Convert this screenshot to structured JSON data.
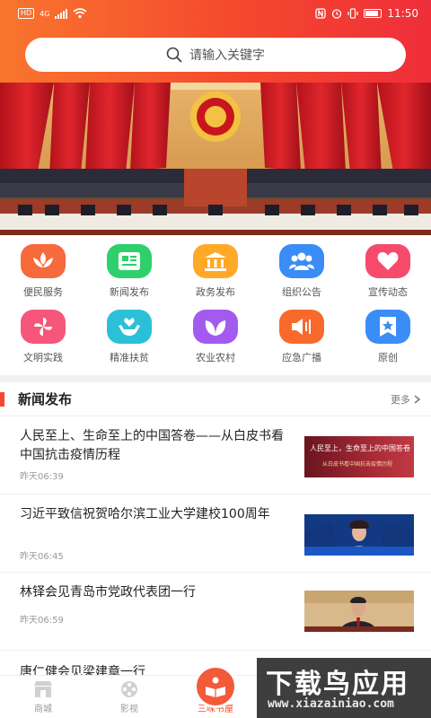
{
  "status_bar": {
    "network": "4G",
    "time": "11:50",
    "hd": "HD"
  },
  "search": {
    "placeholder": "请输入关键字"
  },
  "grid": {
    "items": [
      {
        "label": "便民服务",
        "icon": "flower-icon",
        "color": "#f66a3c"
      },
      {
        "label": "新闻发布",
        "icon": "newspaper-icon",
        "color": "#2fcf6b"
      },
      {
        "label": "政务发布",
        "icon": "government-building-icon",
        "color": "#ffa928"
      },
      {
        "label": "组织公告",
        "icon": "group-icon",
        "color": "#3a8cf6"
      },
      {
        "label": "宣传动态",
        "icon": "heart-icon",
        "color": "#f64a6c"
      },
      {
        "label": "文明实践",
        "icon": "pinwheel-icon",
        "color": "#f6567a"
      },
      {
        "label": "精准扶贫",
        "icon": "hands-heart-icon",
        "color": "#2cc0d8"
      },
      {
        "label": "农业农村",
        "icon": "leaf-icon",
        "color": "#a35bef"
      },
      {
        "label": "应急广播",
        "icon": "speaker-icon",
        "color": "#f76a2c"
      },
      {
        "label": "原创",
        "icon": "star-bookmark-icon",
        "color": "#3a8cf6"
      }
    ]
  },
  "section": {
    "title": "新闻发布",
    "more": "更多"
  },
  "news": [
    {
      "title": "人民至上、生命至上的中国答卷——从白皮书看中国抗击疫情历程",
      "time": "昨天06:39",
      "thumb_line1": "人民至上，生命至上的中国答卷",
      "thumb_line2": "从白皮书看中国抗击疫情历程"
    },
    {
      "title": "习近平致信祝贺哈尔滨工业大学建校100周年",
      "time": "昨天06:45"
    },
    {
      "title": "林铎会见青岛市党政代表团一行",
      "time": "昨天06:59"
    }
  ],
  "news_partial": "唐仁健会见梁建章一行",
  "tabs": [
    {
      "label": "商城",
      "icon": "shop-icon"
    },
    {
      "label": "影视",
      "icon": "film-reel-icon"
    },
    {
      "label": "三味书屋",
      "icon": "reading-book-icon",
      "active": true
    }
  ],
  "watermark": {
    "top": "下载鸟应用",
    "bottom": "www.xiazainiao.com"
  }
}
